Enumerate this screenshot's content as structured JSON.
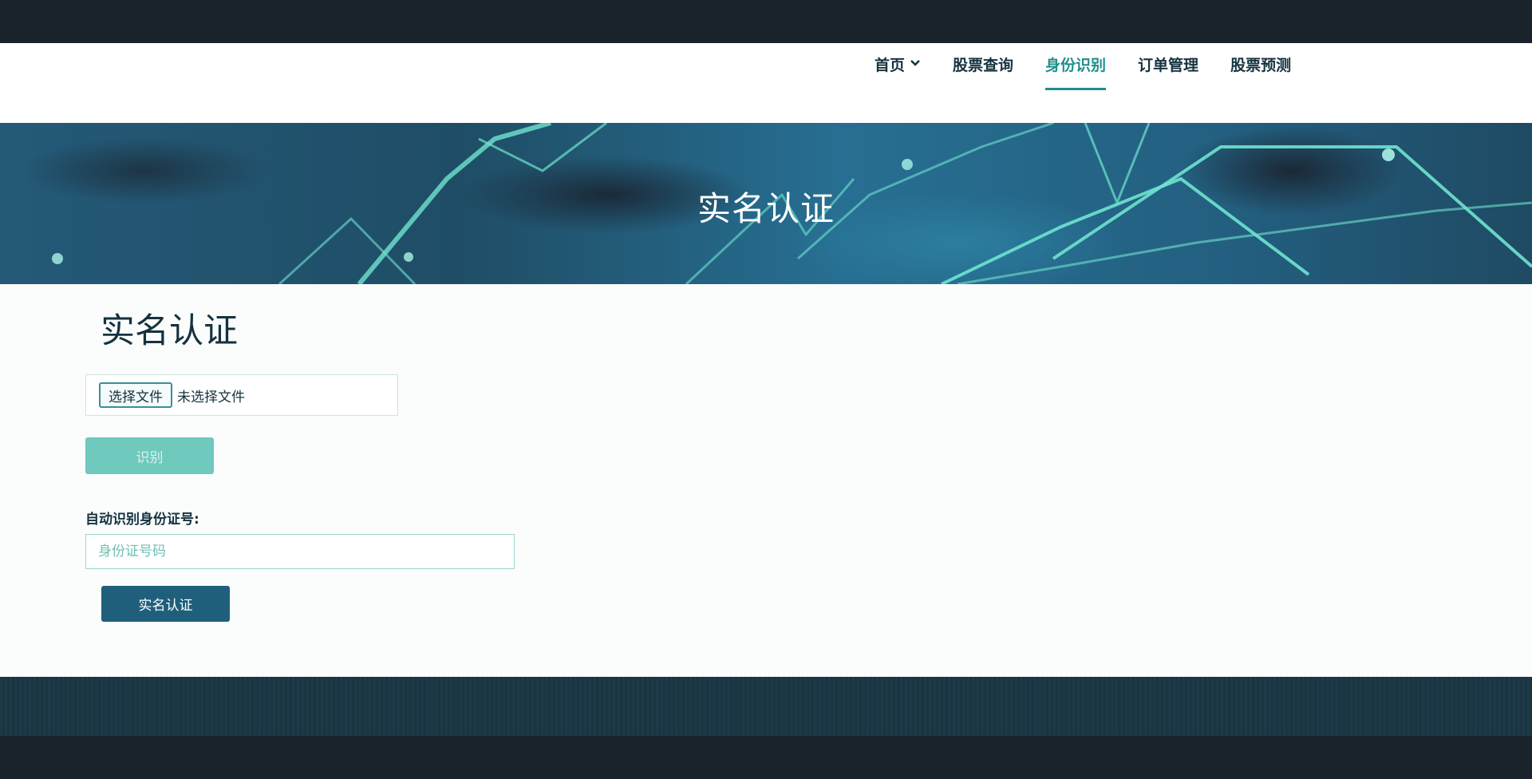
{
  "nav": {
    "items": [
      {
        "label": "首页",
        "has_dropdown": true,
        "icon": "chevron-down-icon"
      },
      {
        "label": "股票查询"
      },
      {
        "label": "身份识别",
        "active": true
      },
      {
        "label": "订单管理"
      },
      {
        "label": "股票预测"
      }
    ]
  },
  "banner": {
    "title": "实名认证"
  },
  "form": {
    "heading": "实名认证",
    "file_button_label": "选择文件",
    "file_status": "未选择文件",
    "recognize_label": "识别",
    "id_label": "自动识别身份证号:",
    "id_placeholder": "身份证号码",
    "id_value": "",
    "submit_label": "实名认证"
  },
  "colors": {
    "accent": "#1e8f8c",
    "recognize_button": "#6fc9bd",
    "submit_button": "#1f5f7b",
    "dark_bars": "#1a222c",
    "text": "#16323f"
  }
}
